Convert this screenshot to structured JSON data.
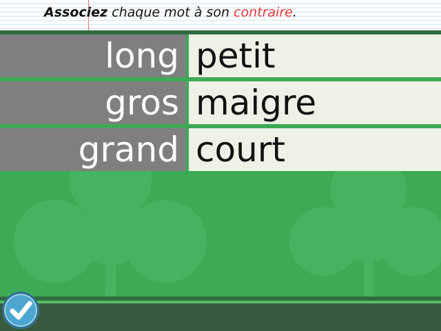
{
  "instruction": {
    "bold": "Associez",
    "middle": " chaque mot à son ",
    "highlight": "contraire",
    "end": "."
  },
  "pairs": [
    {
      "left": "long",
      "right": "petit"
    },
    {
      "left": "gros",
      "right": "maigre"
    },
    {
      "left": "grand",
      "right": "court"
    }
  ],
  "icons": {
    "validate": "checkmark-icon"
  },
  "colors": {
    "background": "#3daa55",
    "left_cell": "#7f7f7f",
    "right_cell": "#eef2e6",
    "highlight": "#e53935",
    "check_button": "#4da6cf"
  }
}
